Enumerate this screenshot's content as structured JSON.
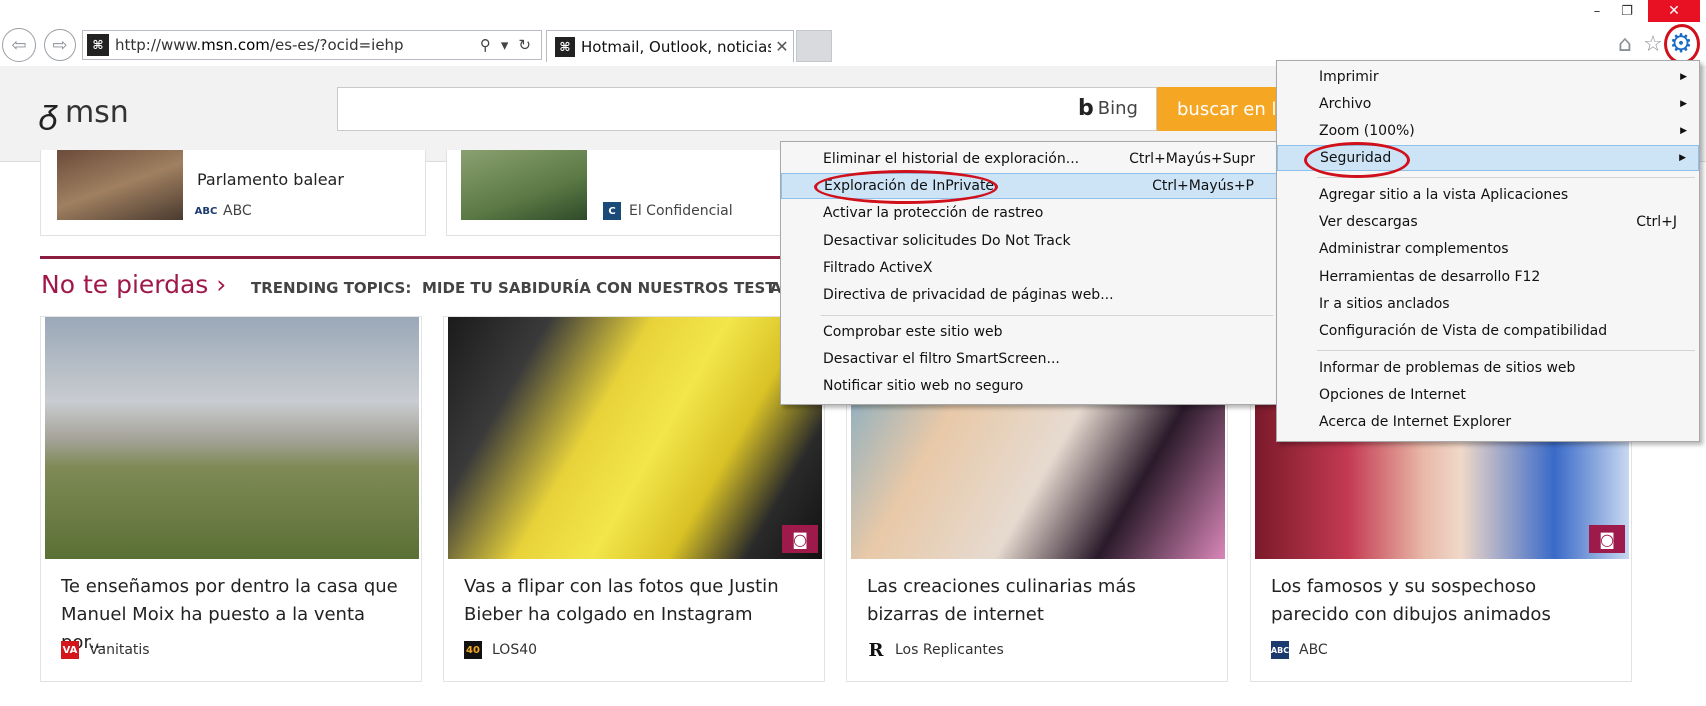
{
  "window": {
    "minimize": "–",
    "maximize": "❐",
    "close": "✕"
  },
  "address_bar": {
    "url_prefix": "http://www.",
    "url_domain": "msn.com",
    "url_suffix": "/es-es/?ocid=iehp",
    "search_glyph": "⚲",
    "dropdown_glyph": "▾",
    "refresh_glyph": "↻"
  },
  "tab": {
    "title": "Hotmail, Outlook, noticias, ...",
    "close": "✕"
  },
  "toolbar": {
    "home_icon": "home-icon",
    "favorites_icon": "star-icon",
    "tools_icon": "gear-icon"
  },
  "msn": {
    "logo_text": "msn",
    "search_placeholder": "",
    "bing_label": "Bing",
    "search_button": "buscar en la"
  },
  "top_cards": [
    {
      "title": "Parlamento balear",
      "source": "ABC"
    },
    {
      "title": "",
      "source": "El Confidencial"
    }
  ],
  "section": {
    "title": "No te pierdas ›",
    "trending_label": "TRENDING TOPICS:",
    "trending_item": "MIDE TU SABIDURÍA CON NUESTROS TEST",
    "trending_more": "A"
  },
  "cards": [
    {
      "title": "Te enseñamos por dentro la casa que Manuel Moix ha puesto a la venta por...",
      "source": "Vanitatis",
      "has_gallery": false
    },
    {
      "title": "Vas a flipar con las fotos que Justin Bieber ha colgado en Instagram",
      "source": "LOS40",
      "has_gallery": true
    },
    {
      "title": "Las creaciones culinarias más bizarras de internet",
      "source": "Los Replicantes",
      "has_gallery": false
    },
    {
      "title": "Los famosos y su sospechoso parecido con dibujos animados",
      "source": "ABC",
      "has_gallery": true
    }
  ],
  "tools_menu": {
    "items": [
      {
        "label": "Imprimir",
        "submenu": true
      },
      {
        "label": "Archivo",
        "submenu": true
      },
      {
        "label": "Zoom (100%)",
        "submenu": true
      },
      {
        "label": "Seguridad",
        "submenu": true,
        "highlighted": true
      },
      {
        "label": "Agregar sitio a la vista Aplicaciones"
      },
      {
        "label": "Ver descargas",
        "shortcut": "Ctrl+J"
      },
      {
        "label": "Administrar complementos"
      },
      {
        "label": "Herramientas de desarrollo F12"
      },
      {
        "label": "Ir a sitios anclados"
      },
      {
        "label": "Configuración de Vista de compatibilidad"
      },
      {
        "label": "Informar de problemas de sitios web"
      },
      {
        "label": "Opciones de Internet"
      },
      {
        "label": "Acerca de Internet Explorer"
      }
    ]
  },
  "security_menu": {
    "items": [
      {
        "label": "Eliminar el historial de exploración...",
        "shortcut": "Ctrl+Mayús+Supr"
      },
      {
        "label": "Exploración de InPrivate",
        "shortcut": "Ctrl+Mayús+P",
        "highlighted": true
      },
      {
        "label": "Activar la protección de rastreo"
      },
      {
        "label": "Desactivar solicitudes Do Not Track"
      },
      {
        "label": "Filtrado ActiveX"
      },
      {
        "label": "Directiva de privacidad de páginas web..."
      },
      {
        "label": "Comprobar este sitio web"
      },
      {
        "label": "Desactivar el filtro SmartScreen..."
      },
      {
        "label": "Notificar sitio web no seguro"
      }
    ]
  },
  "colors": {
    "accent_menu_highlight": "#cde4f7",
    "annotation_red": "#d0101a",
    "section_maroon": "#a0184a",
    "search_orange": "#f5a623"
  }
}
